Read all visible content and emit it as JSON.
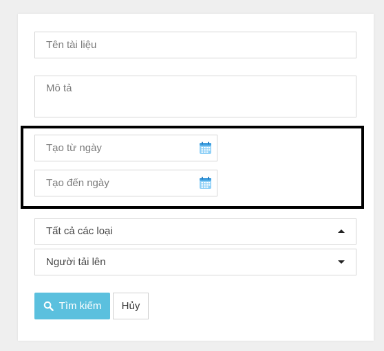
{
  "form": {
    "document_name": {
      "placeholder": "Tên tài liệu"
    },
    "description": {
      "placeholder": "Mô tả"
    },
    "created_from": {
      "placeholder": "Tạo từ ngày"
    },
    "created_to": {
      "placeholder": "Tạo đến ngày"
    },
    "type_select": {
      "value": "Tất cả các loại"
    },
    "uploader_select": {
      "value": "Người tải lên"
    }
  },
  "buttons": {
    "search_label": "Tìm kiếm",
    "cancel_label": "Hủy"
  },
  "colors": {
    "search_button": "#5bc0de",
    "highlight_border": "#000000",
    "calendar_icon": "#4aa8e8"
  },
  "icons": {
    "calendar": "calendar-icon",
    "search": "search-icon",
    "caret_up": "caret-up-icon",
    "caret_down": "caret-down-icon"
  }
}
